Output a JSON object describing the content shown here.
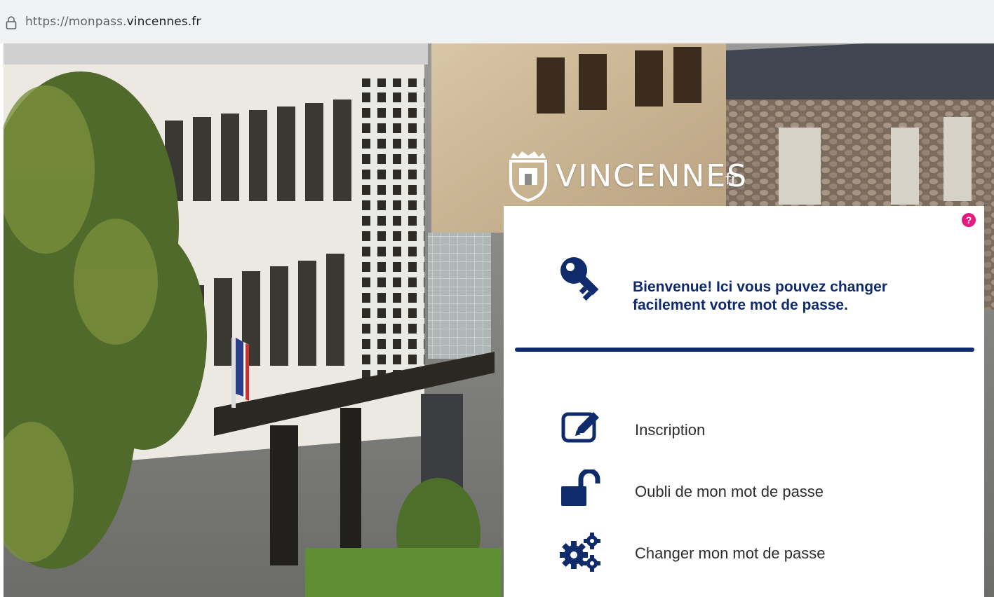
{
  "browser": {
    "url_prefix": "https://monpass.",
    "url_host": "vincennes.fr",
    "lock_icon": "lock-icon"
  },
  "logo": {
    "wordmark": "VINCENNES",
    "suffix": "fr",
    "crest_icon": "city-crest-icon"
  },
  "panel": {
    "help_label": "?",
    "help_color": "#e5197e",
    "welcome_icon": "key-icon",
    "welcome_text": "Bienvenue! Ici vous pouvez changer facilement votre mot de passe.",
    "accent_color": "#0f2b6b",
    "menu": [
      {
        "label": "Inscription",
        "icon": "edit-icon"
      },
      {
        "label": "Oubli de mon mot de passe",
        "icon": "unlock-icon"
      },
      {
        "label": "Changer mon mot de passe",
        "icon": "gears-icon"
      }
    ]
  }
}
